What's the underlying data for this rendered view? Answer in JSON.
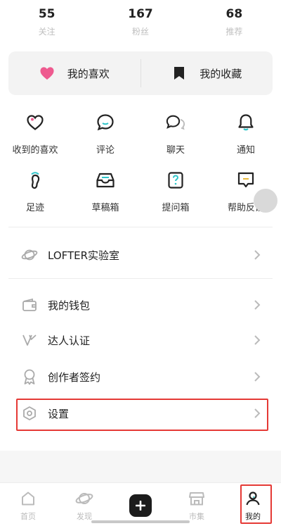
{
  "stats": [
    {
      "value": "55",
      "label": "关注"
    },
    {
      "value": "167",
      "label": "粉丝"
    },
    {
      "value": "68",
      "label": "推荐"
    }
  ],
  "favorites": {
    "likes_label": "我的喜欢",
    "collection_label": "我的收藏"
  },
  "grid": [
    {
      "label": "收到的喜欢",
      "icon": "heart-outline-icon"
    },
    {
      "label": "评论",
      "icon": "comment-icon"
    },
    {
      "label": "聊天",
      "icon": "chat-icon"
    },
    {
      "label": "通知",
      "icon": "bell-icon"
    },
    {
      "label": "足迹",
      "icon": "footprint-icon"
    },
    {
      "label": "草稿箱",
      "icon": "draft-box-icon"
    },
    {
      "label": "提问箱",
      "icon": "question-box-icon"
    },
    {
      "label": "帮助反馈",
      "icon": "help-feedback-icon"
    }
  ],
  "menu": {
    "lab": "LOFTER实验室",
    "wallet": "我的钱包",
    "verify": "达人认证",
    "creator": "创作者签约",
    "settings": "设置"
  },
  "nav": {
    "home": "首页",
    "discover": "发现",
    "market": "市集",
    "mine": "我的"
  },
  "colors": {
    "accent_teal": "#2ec5c9",
    "heart_pink": "#ee5a8f",
    "highlight_red": "#e53935"
  }
}
